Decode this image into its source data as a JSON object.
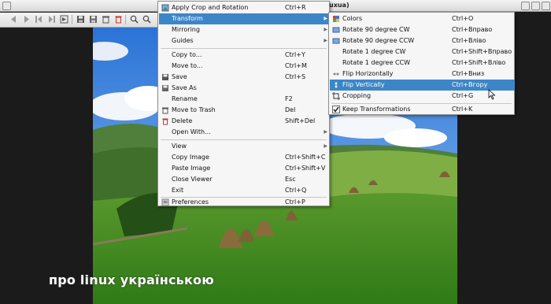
{
  "window": {
    "title": "uxua)"
  },
  "toolbar": {
    "buttons": [
      "back-icon",
      "forward-icon",
      "first-icon",
      "last-icon",
      "save-icon",
      "save-as-icon",
      "delete-icon",
      "trash-icon",
      "zoom-in-icon",
      "zoom-out-icon"
    ]
  },
  "main_menu": {
    "items": [
      {
        "label": "Apply Crop and Rotation",
        "shortcut": "Ctrl+R",
        "icon": "crop-apply-icon"
      },
      {
        "label": "Transform",
        "shortcut": "",
        "submenu": true,
        "highlighted": true
      },
      {
        "label": "Mirroring",
        "shortcut": "",
        "submenu": true
      },
      {
        "label": "Guides",
        "shortcut": "",
        "submenu": true
      },
      {
        "label": "Copy to...",
        "shortcut": "Ctrl+Y"
      },
      {
        "label": "Move to...",
        "shortcut": "Ctrl+M"
      },
      {
        "label": "Save",
        "shortcut": "Ctrl+S",
        "icon": "save-icon"
      },
      {
        "label": "Save As",
        "shortcut": "",
        "icon": "save-as-icon"
      },
      {
        "label": "Rename",
        "shortcut": "F2"
      },
      {
        "label": "Move to Trash",
        "shortcut": "Del",
        "icon": "trash-icon"
      },
      {
        "label": "Delete",
        "shortcut": "Shift+Del",
        "icon": "delete-icon"
      },
      {
        "label": "Open With...",
        "shortcut": "",
        "submenu": true
      },
      {
        "label": "View",
        "shortcut": "",
        "submenu": true
      },
      {
        "label": "Copy Image",
        "shortcut": "Ctrl+Shift+C"
      },
      {
        "label": "Paste Image",
        "shortcut": "Ctrl+Shift+V"
      },
      {
        "label": "Close Viewer",
        "shortcut": "Esc"
      },
      {
        "label": "Exit",
        "shortcut": "Ctrl+Q"
      },
      {
        "label": "Preferences",
        "shortcut": "Ctrl+P",
        "icon": "preferences-icon"
      }
    ]
  },
  "transform_menu": {
    "items": [
      {
        "label": "Colors",
        "shortcut": "Ctrl+O",
        "icon": "colors-icon"
      },
      {
        "label": "Rotate 90 degree CW",
        "shortcut": "Ctrl+Вправо",
        "icon": "rotate-cw-icon"
      },
      {
        "label": "Rotate 90 degree CCW",
        "shortcut": "Ctrl+Вліво",
        "icon": "rotate-ccw-icon"
      },
      {
        "label": "Rotate 1 degree CW",
        "shortcut": "Ctrl+Shift+Вправо"
      },
      {
        "label": "Rotate 1 degree CCW",
        "shortcut": "Ctrl+Shift+Вліво"
      },
      {
        "label": "Flip Horizontally",
        "shortcut": "Ctrl+Вниз",
        "icon": "flip-horizontal-icon"
      },
      {
        "label": "Flip Vertically",
        "shortcut": "Ctrl+Вгору",
        "icon": "flip-vertical-icon",
        "highlighted": true
      },
      {
        "label": "Cropping",
        "shortcut": "Ctrl+G",
        "icon": "crop-icon"
      },
      {
        "label": "Keep Transformations",
        "shortcut": "Ctrl+K",
        "checked": true
      }
    ]
  },
  "watermark": "про linux українською",
  "colors": {
    "highlight": "#3c86c8",
    "menu_bg": "#f6f6f6",
    "delete_icon": "#d03030"
  }
}
